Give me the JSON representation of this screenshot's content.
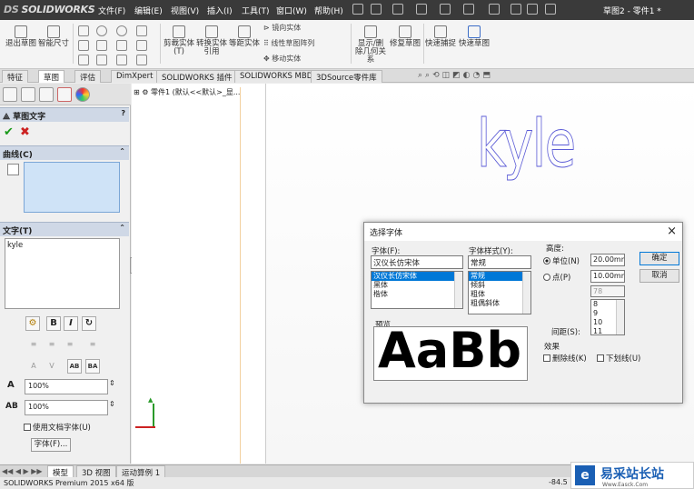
{
  "app": {
    "logo": "SOLIDWORKS",
    "window_title": "草图2 - 零件1 *"
  },
  "menu": [
    "文件(F)",
    "编辑(E)",
    "视图(V)",
    "插入(I)",
    "工具(T)",
    "窗口(W)",
    "帮助(H)"
  ],
  "ribbon": {
    "exit_sketch": "退出草图",
    "smart_dim": "智能尺寸",
    "trim": "剪裁实体(T)",
    "convert": "转换实体引用",
    "offset": "等距实体",
    "mirror": "镜向实体",
    "linear_pattern": "线性草图阵列",
    "move": "移动实体",
    "show_relations": "显示/删除几何关系",
    "repair": "修复草图",
    "quick_snap": "快速捕捉",
    "rapid_sketch": "快速草图"
  },
  "tabs": [
    "特征",
    "草图",
    "评估",
    "DimXpert",
    "SOLIDWORKS 插件",
    "SOLIDWORKS MBD",
    "3DSource零件库"
  ],
  "active_tab": "草图",
  "panel": {
    "title": "草图文字",
    "curves_label": "曲线(C)",
    "text_label": "文字(T)",
    "text_value": "kyle",
    "width_pct": "100%",
    "spacing_pct": "100%",
    "use_doc_font": "使用文档字体(U)",
    "font_button": "字体(F)..."
  },
  "tree": {
    "root": "零件1 (默认<<默认>_显..."
  },
  "sketch_text": "kyle",
  "dialog": {
    "title": "选择字体",
    "font_label": "字体(F):",
    "font_value": "汉仪长仿宋体",
    "font_list": [
      "汉仪长仿宋体",
      "黑体",
      "楷体"
    ],
    "style_label": "字体样式(Y):",
    "style_value": "常规",
    "style_list": [
      "常规",
      "倾斜",
      "粗体",
      "粗偶斜体"
    ],
    "height_label": "高度:",
    "unit_label": "单位(N)",
    "unit_value": "20.00mm",
    "point_label": "点(P)",
    "point_value": "10.00mm",
    "size_value": "78",
    "size_list": [
      "8",
      "9",
      "10",
      "11"
    ],
    "spacing_label": "间距(S):",
    "preview_label": "预览",
    "preview_text": "AaBb",
    "effects_label": "效果",
    "strikeout": "删除线(K)",
    "underline": "下划线(U)",
    "ok": "确定",
    "cancel": "取消"
  },
  "bottom_tabs": [
    "模型",
    "3D 视图",
    "运动算例 1"
  ],
  "status": {
    "text": "SOLIDWORKS Premium 2015 x64 版",
    "coord": "-84.5"
  },
  "watermark": {
    "text": "易采站长站",
    "sub": "Www.Easck.Com"
  }
}
